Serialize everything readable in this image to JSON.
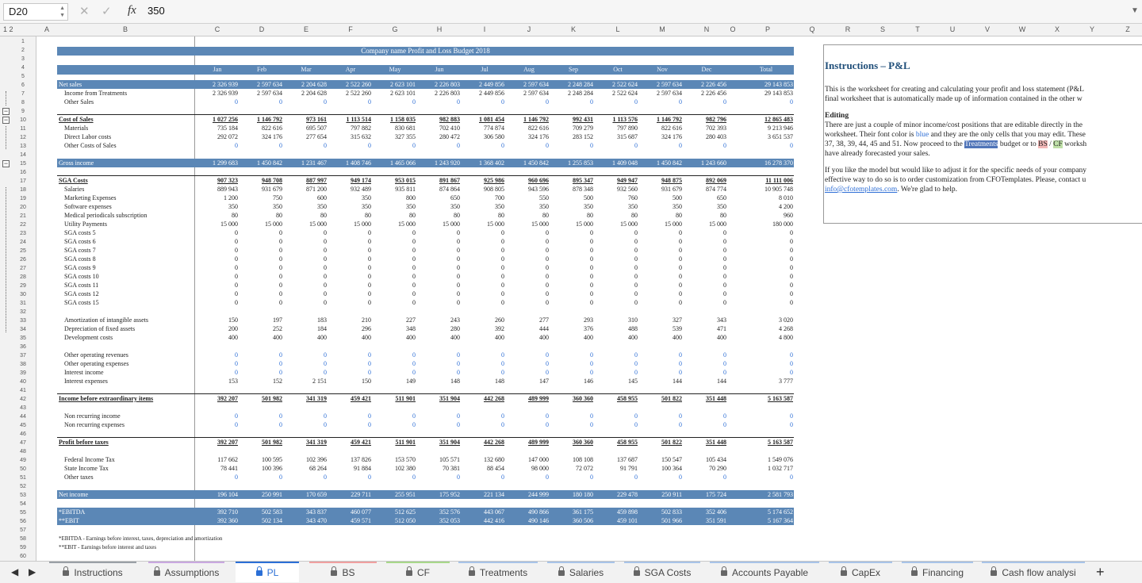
{
  "formula_bar": {
    "cell_ref": "D20",
    "formula_value": "350",
    "fx_label": "fx"
  },
  "outline_levels": [
    "1",
    "2"
  ],
  "columns": [
    "A",
    "B",
    "C",
    "D",
    "E",
    "F",
    "G",
    "H",
    "I",
    "J",
    "K",
    "L",
    "M",
    "N",
    "O",
    "P",
    "Q",
    "R",
    "S",
    "T",
    "U",
    "V",
    "W",
    "X",
    "Y",
    "Z"
  ],
  "rows": [
    "1",
    "2",
    "3",
    "4",
    "5",
    "6",
    "7",
    "8",
    "9",
    "10",
    "11",
    "12",
    "13",
    "14",
    "15",
    "16",
    "17",
    "18",
    "19",
    "20",
    "21",
    "22",
    "23",
    "24",
    "25",
    "26",
    "27",
    "28",
    "29",
    "30",
    "31",
    "32",
    "33",
    "34",
    "35",
    "36",
    "37",
    "38",
    "39",
    "40",
    "41",
    "42",
    "43",
    "44",
    "45",
    "46",
    "47",
    "48",
    "49",
    "50",
    "51",
    "52",
    "53",
    "54",
    "55",
    "56",
    "57",
    "58",
    "59",
    "60"
  ],
  "report": {
    "title": "Company name Profit and Loss Budget 2018",
    "months": [
      "Jan",
      "Feb",
      "Mar",
      "Apr",
      "May",
      "Jun",
      "Jul",
      "Aug",
      "Sep",
      "Oct",
      "Nov",
      "Dec",
      "Total"
    ],
    "lines": [
      {
        "row": 6,
        "label": "Net sales",
        "values": [
          "2 326 939",
          "2 597 634",
          "2 204 628",
          "2 522 260",
          "2 623 101",
          "2 226 803",
          "2 449 856",
          "2 597 634",
          "2 248 284",
          "2 522 624",
          "2 597 634",
          "2 226 456",
          "29 143 853"
        ],
        "style": "band"
      },
      {
        "row": 7,
        "label": "Income from Treatments",
        "values": [
          "2 326 939",
          "2 597 634",
          "2 204 628",
          "2 522 260",
          "2 623 101",
          "2 226 803",
          "2 449 856",
          "2 597 634",
          "2 248 284",
          "2 522 624",
          "2 597 634",
          "2 226 456",
          "29 143 853"
        ],
        "style": "sub"
      },
      {
        "row": 8,
        "label": "Other Sales",
        "values": [
          "0",
          "0",
          "0",
          "0",
          "0",
          "0",
          "0",
          "0",
          "0",
          "0",
          "0",
          "0",
          "0"
        ],
        "style": "subblue"
      },
      {
        "row": 10,
        "label": "Cost of Sales",
        "values": [
          "1 027 256",
          "1 146 792",
          "973 161",
          "1 113 514",
          "1 158 035",
          "982 883",
          "1 081 454",
          "1 146 792",
          "992 431",
          "1 113 576",
          "1 146 792",
          "982 796",
          "12 865 483"
        ],
        "style": "head"
      },
      {
        "row": 11,
        "label": "Materials",
        "values": [
          "735 184",
          "822 616",
          "695 507",
          "797 882",
          "830 681",
          "702 410",
          "774 874",
          "822 616",
          "709 279",
          "797 890",
          "822 616",
          "702 393",
          "9 213 946"
        ],
        "style": "sub"
      },
      {
        "row": 12,
        "label": "Direct Labor costs",
        "values": [
          "292 072",
          "324 176",
          "277 654",
          "315 632",
          "327 355",
          "280 472",
          "306 580",
          "324 176",
          "283 152",
          "315 687",
          "324 176",
          "280 403",
          "3 651 537"
        ],
        "style": "sub"
      },
      {
        "row": 13,
        "label": "Other Costs of Sales",
        "values": [
          "0",
          "0",
          "0",
          "0",
          "0",
          "0",
          "0",
          "0",
          "0",
          "0",
          "0",
          "0",
          "0"
        ],
        "style": "subblue"
      },
      {
        "row": 15,
        "label": "Gross income",
        "values": [
          "1 299 683",
          "1 450 842",
          "1 231 467",
          "1 408 746",
          "1 465 066",
          "1 243 920",
          "1 368 402",
          "1 450 842",
          "1 255 853",
          "1 409 048",
          "1 450 842",
          "1 243 660",
          "16 278 370"
        ],
        "style": "band"
      },
      {
        "row": 17,
        "label": "SGA Costs",
        "values": [
          "907 323",
          "948 708",
          "887 997",
          "949 174",
          "953 015",
          "891 867",
          "925 986",
          "960 696",
          "895 347",
          "949 947",
          "948 875",
          "892 069",
          "11 111 006"
        ],
        "style": "head"
      },
      {
        "row": 18,
        "label": "Salaries",
        "values": [
          "889 943",
          "931 679",
          "871 200",
          "932 489",
          "935 811",
          "874 864",
          "908 805",
          "943 596",
          "878 348",
          "932 560",
          "931 679",
          "874 774",
          "10 905 748"
        ],
        "style": "sub"
      },
      {
        "row": 19,
        "label": "Marketing Expenses",
        "values": [
          "1 200",
          "750",
          "600",
          "350",
          "800",
          "650",
          "700",
          "550",
          "500",
          "760",
          "500",
          "650",
          "8 010"
        ],
        "style": "sub"
      },
      {
        "row": 20,
        "label": "Software expenses",
        "values": [
          "350",
          "350",
          "350",
          "350",
          "350",
          "350",
          "350",
          "350",
          "350",
          "350",
          "350",
          "350",
          "4 200"
        ],
        "style": "sub"
      },
      {
        "row": 21,
        "label": "Medical periodicals subscription",
        "values": [
          "80",
          "80",
          "80",
          "80",
          "80",
          "80",
          "80",
          "80",
          "80",
          "80",
          "80",
          "80",
          "960"
        ],
        "style": "sub"
      },
      {
        "row": 22,
        "label": "Utility Payments",
        "values": [
          "15 000",
          "15 000",
          "15 000",
          "15 000",
          "15 000",
          "15 000",
          "15 000",
          "15 000",
          "15 000",
          "15 000",
          "15 000",
          "15 000",
          "180 000"
        ],
        "style": "sub"
      },
      {
        "row": 23,
        "label": "SGA costs 5",
        "values": [
          "0",
          "0",
          "0",
          "0",
          "0",
          "0",
          "0",
          "0",
          "0",
          "0",
          "0",
          "0",
          "0"
        ],
        "style": "sub"
      },
      {
        "row": 24,
        "label": "SGA costs 6",
        "values": [
          "0",
          "0",
          "0",
          "0",
          "0",
          "0",
          "0",
          "0",
          "0",
          "0",
          "0",
          "0",
          "0"
        ],
        "style": "sub"
      },
      {
        "row": 25,
        "label": "SGA costs 7",
        "values": [
          "0",
          "0",
          "0",
          "0",
          "0",
          "0",
          "0",
          "0",
          "0",
          "0",
          "0",
          "0",
          "0"
        ],
        "style": "sub"
      },
      {
        "row": 26,
        "label": "SGA costs 8",
        "values": [
          "0",
          "0",
          "0",
          "0",
          "0",
          "0",
          "0",
          "0",
          "0",
          "0",
          "0",
          "0",
          "0"
        ],
        "style": "sub"
      },
      {
        "row": 27,
        "label": "SGA costs 9",
        "values": [
          "0",
          "0",
          "0",
          "0",
          "0",
          "0",
          "0",
          "0",
          "0",
          "0",
          "0",
          "0",
          "0"
        ],
        "style": "sub"
      },
      {
        "row": 28,
        "label": "SGA costs 10",
        "values": [
          "0",
          "0",
          "0",
          "0",
          "0",
          "0",
          "0",
          "0",
          "0",
          "0",
          "0",
          "0",
          "0"
        ],
        "style": "sub"
      },
      {
        "row": 29,
        "label": "SGA costs 11",
        "values": [
          "0",
          "0",
          "0",
          "0",
          "0",
          "0",
          "0",
          "0",
          "0",
          "0",
          "0",
          "0",
          "0"
        ],
        "style": "sub"
      },
      {
        "row": 30,
        "label": "SGA costs 12",
        "values": [
          "0",
          "0",
          "0",
          "0",
          "0",
          "0",
          "0",
          "0",
          "0",
          "0",
          "0",
          "0",
          "0"
        ],
        "style": "sub"
      },
      {
        "row": 31,
        "label": "SGA costs 15",
        "values": [
          "0",
          "0",
          "0",
          "0",
          "0",
          "0",
          "0",
          "0",
          "0",
          "0",
          "0",
          "0",
          "0"
        ],
        "style": "sub"
      },
      {
        "row": 33,
        "label": "Amortization of intangible assets",
        "values": [
          "150",
          "197",
          "183",
          "210",
          "227",
          "243",
          "260",
          "277",
          "293",
          "310",
          "327",
          "343",
          "3 020"
        ],
        "style": "sub"
      },
      {
        "row": 34,
        "label": "Depreciation of fixed assets",
        "values": [
          "200",
          "252",
          "184",
          "296",
          "348",
          "280",
          "392",
          "444",
          "376",
          "488",
          "539",
          "471",
          "4 268"
        ],
        "style": "sub"
      },
      {
        "row": 35,
        "label": "Development costs",
        "values": [
          "400",
          "400",
          "400",
          "400",
          "400",
          "400",
          "400",
          "400",
          "400",
          "400",
          "400",
          "400",
          "4 800"
        ],
        "style": "sub"
      },
      {
        "row": 37,
        "label": "Other operating revenues",
        "values": [
          "0",
          "0",
          "0",
          "0",
          "0",
          "0",
          "0",
          "0",
          "0",
          "0",
          "0",
          "0",
          "0"
        ],
        "style": "subblue"
      },
      {
        "row": 38,
        "label": "Other operating expenses",
        "values": [
          "0",
          "0",
          "0",
          "0",
          "0",
          "0",
          "0",
          "0",
          "0",
          "0",
          "0",
          "0",
          "0"
        ],
        "style": "subblue"
      },
      {
        "row": 39,
        "label": "Interest income",
        "values": [
          "0",
          "0",
          "0",
          "0",
          "0",
          "0",
          "0",
          "0",
          "0",
          "0",
          "0",
          "0",
          "0"
        ],
        "style": "subblue"
      },
      {
        "row": 40,
        "label": "Interest expenses",
        "values": [
          "153",
          "152",
          "2 151",
          "150",
          "149",
          "148",
          "148",
          "147",
          "146",
          "145",
          "144",
          "144",
          "3 777"
        ],
        "style": "sub"
      },
      {
        "row": 42,
        "label": "Income before extraordinary items",
        "values": [
          "392 207",
          "501 982",
          "341 319",
          "459 421",
          "511 901",
          "351 904",
          "442 268",
          "489 999",
          "360 360",
          "458 955",
          "501 822",
          "351 448",
          "5 163 587"
        ],
        "style": "head"
      },
      {
        "row": 44,
        "label": "Non recurring income",
        "values": [
          "0",
          "0",
          "0",
          "0",
          "0",
          "0",
          "0",
          "0",
          "0",
          "0",
          "0",
          "0",
          "0"
        ],
        "style": "subblue"
      },
      {
        "row": 45,
        "label": "Non recurring expenses",
        "values": [
          "0",
          "0",
          "0",
          "0",
          "0",
          "0",
          "0",
          "0",
          "0",
          "0",
          "0",
          "0",
          "0"
        ],
        "style": "subblue"
      },
      {
        "row": 47,
        "label": "Profit before taxes",
        "values": [
          "392 207",
          "501 982",
          "341 319",
          "459 421",
          "511 901",
          "351 904",
          "442 268",
          "489 999",
          "360 360",
          "458 955",
          "501 822",
          "351 448",
          "5 163 587"
        ],
        "style": "head"
      },
      {
        "row": 49,
        "label": "Federal Income Tax",
        "values": [
          "117 662",
          "100 595",
          "102 396",
          "137 826",
          "153 570",
          "105 571",
          "132 680",
          "147 000",
          "108 108",
          "137 687",
          "150 547",
          "105 434",
          "1 549 076"
        ],
        "style": "sub"
      },
      {
        "row": 50,
        "label": "State Income Tax",
        "values": [
          "78 441",
          "100 396",
          "68 264",
          "91 884",
          "102 380",
          "70 381",
          "88 454",
          "98 000",
          "72 072",
          "91 791",
          "100 364",
          "70 290",
          "1 032 717"
        ],
        "style": "sub"
      },
      {
        "row": 51,
        "label": "Other taxes",
        "values": [
          "0",
          "0",
          "0",
          "0",
          "0",
          "0",
          "0",
          "0",
          "0",
          "0",
          "0",
          "0",
          "0"
        ],
        "style": "subblue"
      },
      {
        "row": 53,
        "label": "Net income",
        "values": [
          "196 104",
          "250 991",
          "170 659",
          "229 711",
          "255 951",
          "175 952",
          "221 134",
          "244 999",
          "180 180",
          "229 478",
          "250 911",
          "175 724",
          "2 581 793"
        ],
        "style": "band"
      },
      {
        "row": 55,
        "label": "*EBITDA",
        "values": [
          "392 710",
          "502 583",
          "343 837",
          "460 077",
          "512 625",
          "352 576",
          "443 067",
          "490 866",
          "361 175",
          "459 898",
          "502 833",
          "352 406",
          "5 174 652"
        ],
        "style": "band2"
      },
      {
        "row": 56,
        "label": "**EBIT",
        "values": [
          "392 360",
          "502 134",
          "343 470",
          "459 571",
          "512 050",
          "352 053",
          "442 416",
          "490 146",
          "360 506",
          "459 101",
          "501 966",
          "351 591",
          "5 167 364"
        ],
        "style": "band2"
      }
    ],
    "footnotes": [
      "*EBITDA - Earnings before interest, taxes, depreciation and amortization",
      "**EBIT - Earnings before interest and taxes"
    ]
  },
  "instructions": {
    "title": "Instructions – P&L",
    "p1a": "This is the worksheet  for creating and calculating your profit and loss statement (P&L",
    "p1b": "final worksheet that is automatically made up of information contained in the other w",
    "editing_label": "Editing",
    "p2a": "There are just a couple of minor income/cost positions that are editable directly in the",
    "p2b_1": "worksheet. Their font color is ",
    "p2b_blue": "blue",
    "p2b_2": " and they are the only cells that you may edit. These",
    "p2c_1": "37, 38, 39, 44, 45 and 51. Now proceed to the ",
    "p2c_treat": "Treatments",
    "p2c_2": " budget or to ",
    "p2c_bs": "BS",
    "p2c_3": " / ",
    "p2c_cf": "CF",
    "p2c_4": " worksh",
    "p2d": "have already forecasted your sales.",
    "p3a": "If you like the model but would like to adjust it for the specific needs of your company",
    "p3b": "effective way to do so is to order customization from CFOTemplates. Please, contact u",
    "p3c_link": "info@cfotemplates.com",
    "p3c_rest": ". We're glad to help."
  },
  "tabs": [
    {
      "label": "Instructions",
      "locked": true,
      "active": false,
      "color": "#9aa0a6"
    },
    {
      "label": "Assumptions",
      "locked": true,
      "active": false,
      "color": "#c9a8e0"
    },
    {
      "label": "PL",
      "locked": true,
      "active": true,
      "color": "#2b6fd6"
    },
    {
      "label": "BS",
      "locked": true,
      "active": false,
      "color": "#f0a0a0"
    },
    {
      "label": "CF",
      "locked": true,
      "active": false,
      "color": "#a8d88a"
    },
    {
      "label": "Treatments",
      "locked": true,
      "active": false,
      "color": "#a8c4e8"
    },
    {
      "label": "Salaries",
      "locked": true,
      "active": false,
      "color": "#a8c4e8"
    },
    {
      "label": "SGA Costs",
      "locked": true,
      "active": false,
      "color": "#a8c4e8"
    },
    {
      "label": "Accounts Payable",
      "locked": true,
      "active": false,
      "color": "#a8c4e8"
    },
    {
      "label": "CapEx",
      "locked": true,
      "active": false,
      "color": "#a8c4e8"
    },
    {
      "label": "Financing",
      "locked": true,
      "active": false,
      "color": "#a8c4e8"
    },
    {
      "label": "Cash flow analysi",
      "locked": true,
      "active": false,
      "color": "#a8c4e8"
    }
  ],
  "add_tab_label": "+",
  "colors": {
    "band": "#5b87b6",
    "accent": "#2b6fd6",
    "editable": "#2f6fd6"
  }
}
